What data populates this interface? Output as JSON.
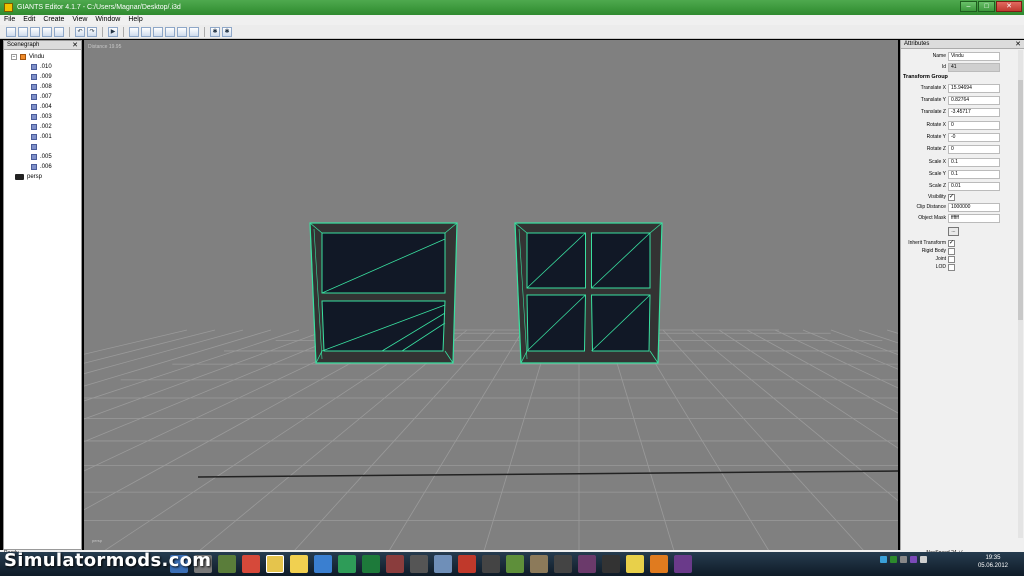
{
  "window": {
    "title": "GIANTS Editor 4.1.7 - C:/Users/Magnar/Desktop/.i3d",
    "btn_min": "–",
    "btn_max": "□",
    "btn_close": "✕"
  },
  "menu": [
    "File",
    "Edit",
    "Create",
    "View",
    "Window",
    "Help"
  ],
  "toolbar": {
    "icons": [
      "new-icon",
      "open-icon",
      "import-icon",
      "save-icon",
      "save-as-icon",
      "undo-icon",
      "redo-icon",
      "play-icon",
      "select-icon",
      "move-icon",
      "terrain-icon",
      "paint-icon",
      "foliage-icon",
      "settings-icon",
      "render-icon"
    ]
  },
  "scenegraph": {
    "title": "Scenegraph",
    "close": "✕",
    "root": "Vindu",
    "children": [
      ".010",
      ".009",
      ".008",
      ".007",
      ".004",
      ".003",
      ".002",
      ".001",
      "",
      ".005",
      ".006"
    ],
    "camera": "persp"
  },
  "viewport": {
    "distance_label": "Distance 19.95",
    "corner_label": "persp"
  },
  "attributes": {
    "title": "Attributes",
    "close": "✕",
    "name_label": "Name",
    "name_value": "Vindu",
    "id_label": "Id",
    "id_value": "41",
    "section_transform": "Transform Group",
    "translate_x_label": "Translate X",
    "translate_x": "15.94694",
    "translate_y_label": "Translate Y",
    "translate_y": "0.82764",
    "translate_z_label": "Translate Z",
    "translate_z": "-3.45717",
    "rotate_x_label": "Rotate X",
    "rotate_x": "0",
    "rotate_y_label": "Rotate Y",
    "rotate_y": "-0",
    "rotate_z_label": "Rotate Z",
    "rotate_z": "0",
    "scale_x_label": "Scale X",
    "scale_x": "0.1",
    "scale_y_label": "Scale Y",
    "scale_y": "0.1",
    "scale_z_label": "Scale Z",
    "scale_z": "0.01",
    "visibility_label": "Visibility",
    "visibility": "✓",
    "clip_label": "Clip Distance",
    "clip_value": "1000000",
    "mask_label": "Object Mask",
    "mask_value": "ffffff",
    "more_btn": "...",
    "inherit_label": "Inherit Transform",
    "inherit": "✓",
    "rigid_label": "Rigid Body",
    "joint_label": "Joint",
    "lod_label": "LOD"
  },
  "status": {
    "left": "Ready",
    "right": "NavSpeed 24 +/-"
  },
  "taskbar": {
    "time": "19:35",
    "date": "05.06.2012"
  },
  "watermark": "Simulatormods.com",
  "colors": {
    "wire": "#39e0a0",
    "window_fill": "#111826",
    "frame": "#333333",
    "grid": "#9a9a9a"
  }
}
